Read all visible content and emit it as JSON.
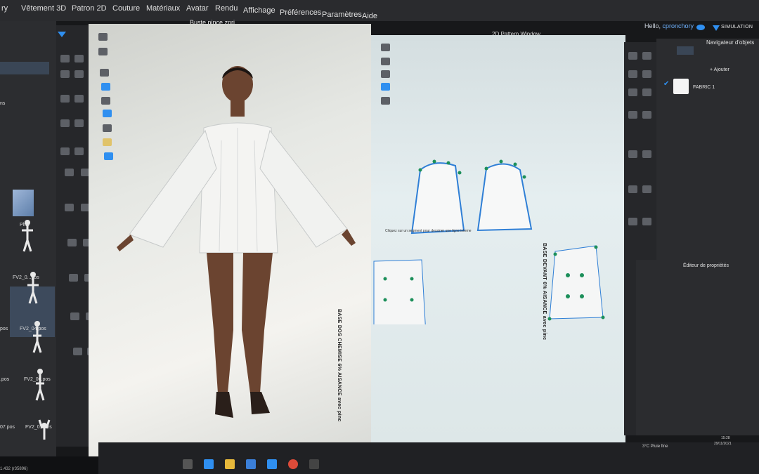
{
  "menu": {
    "items": [
      "ry",
      "Vêtement 3D",
      "Patron 2D",
      "Couture",
      "Matériaux",
      "Avatar",
      "Rendu",
      "Affichage",
      "Préférences",
      "Paramètres",
      "Aide"
    ]
  },
  "header": {
    "hello_prefix": "Hello,",
    "username": "cpronchory",
    "simulation_label": "SIMULATION"
  },
  "viewport3d": {
    "title": "Buste pince.zprj"
  },
  "viewport2d": {
    "title": "2D Pattern Window",
    "hint": "Cliquez sur un segment pour dessiner une ligne interne",
    "piece_back": "BASE DOS CHEMISE 6% AISANCE avec pinc",
    "piece_front": "BASE DEVANT 6% AISANCE avec pinc"
  },
  "left_panel": {
    "items": [
      "Plus",
      "FV2_0...pos",
      "FV2_04.pos",
      "FV2_06.pos",
      "FV2_0...pos"
    ],
    "partial_items": [
      "ns",
      "pos",
      ".pos",
      "07.pos"
    ],
    "status": "1.432 (r35896)"
  },
  "object_navigator": {
    "title": "Navigateur d'objets",
    "add_label": "+ Ajouter",
    "fabric_name": "FABRIC 1"
  },
  "property_editor": {
    "title": "Éditeur de propriétés"
  },
  "taskbar": {
    "weather": "3°C Pluie fine",
    "time": "15:28",
    "date": "29/11/2021"
  },
  "colors": {
    "accent": "#2f8ff0",
    "point": "#1c8f5a",
    "pattern_outline": "#2f7fd6"
  }
}
